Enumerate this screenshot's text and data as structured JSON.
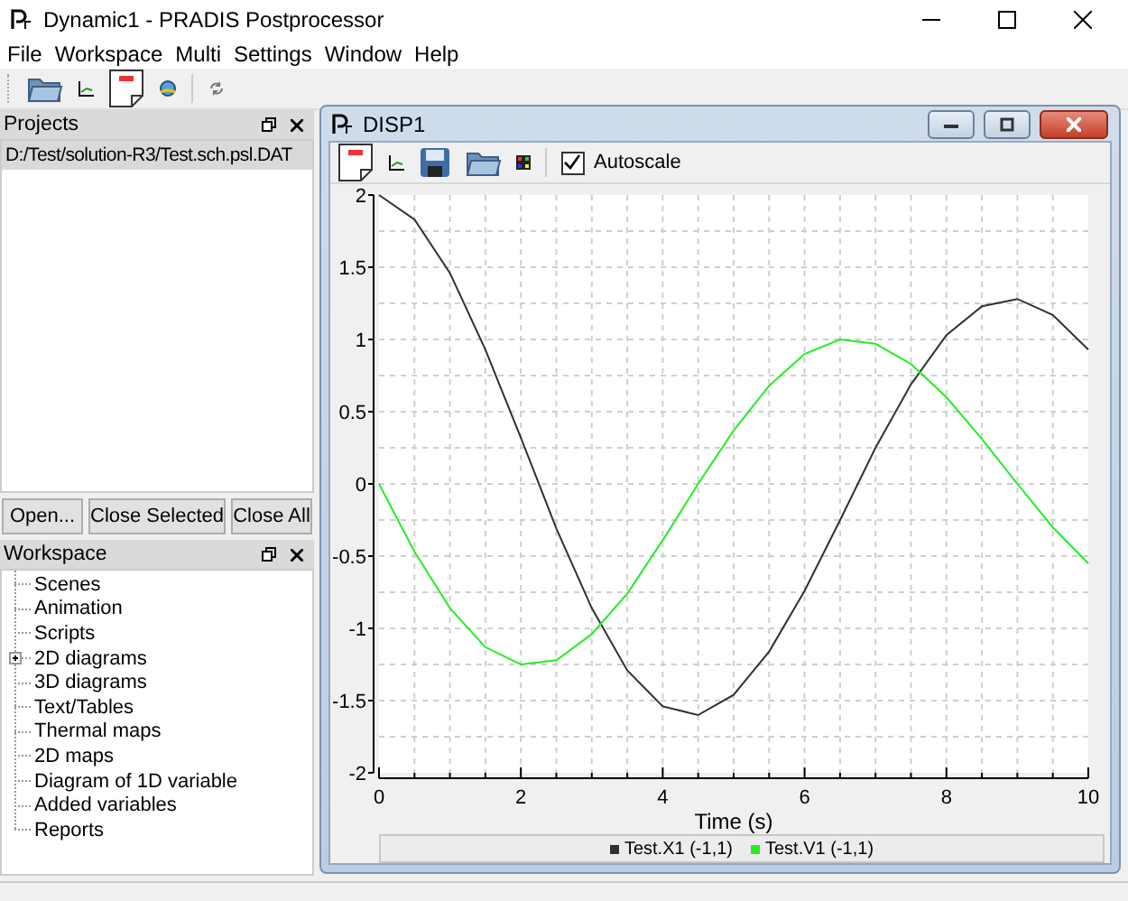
{
  "window": {
    "title": "Dynamic1 - PRADIS Postprocessor"
  },
  "menu": [
    "File",
    "Workspace",
    "Multi",
    "Settings",
    "Window",
    "Help"
  ],
  "projects_panel": {
    "title": "Projects",
    "items": [
      {
        "label": "D:/Test/solution-R3/Test.sch.psl.DAT",
        "selected": true
      }
    ],
    "buttons": [
      "Open...",
      "Close Selected",
      "Close All"
    ]
  },
  "workspace_panel": {
    "title": "Workspace",
    "items": [
      {
        "label": "Scenes",
        "expandable": false
      },
      {
        "label": "Animation",
        "expandable": false
      },
      {
        "label": "Scripts",
        "expandable": false
      },
      {
        "label": "2D diagrams",
        "expandable": true
      },
      {
        "label": "3D diagrams",
        "expandable": false
      },
      {
        "label": "Text/Tables",
        "expandable": false
      },
      {
        "label": "Thermal maps",
        "expandable": false
      },
      {
        "label": "2D maps",
        "expandable": false
      },
      {
        "label": "Diagram of 1D variable",
        "expandable": false
      },
      {
        "label": "Added variables",
        "expandable": false
      },
      {
        "label": "Reports",
        "expandable": false
      }
    ]
  },
  "plot_window": {
    "title": "DISP1",
    "autoscale": {
      "label": "Autoscale",
      "checked": true
    },
    "chart_data": {
      "type": "line",
      "xlabel": "Time (s)",
      "grid": true,
      "x": [
        0,
        0.5,
        1,
        1.5,
        2,
        2.5,
        3,
        3.5,
        4,
        4.5,
        5,
        5.5,
        6,
        6.5,
        7,
        7.5,
        8,
        8.5,
        9,
        9.5,
        10
      ],
      "series": [
        {
          "name": "Test.X1 (-1,1)",
          "color": "#303030",
          "values": [
            2.0,
            1.83,
            1.46,
            0.93,
            0.32,
            -0.31,
            -0.86,
            -1.29,
            -1.54,
            -1.6,
            -1.46,
            -1.16,
            -0.74,
            -0.25,
            0.25,
            0.69,
            1.03,
            1.23,
            1.28,
            1.17,
            0.93
          ]
        },
        {
          "name": "Test.V1 (-1,1)",
          "color": "#22ee22",
          "values": [
            0,
            -0.47,
            -0.86,
            -1.13,
            -1.25,
            -1.22,
            -1.04,
            -0.76,
            -0.39,
            0,
            0.37,
            0.68,
            0.9,
            1.0,
            0.97,
            0.83,
            0.6,
            0.31,
            0,
            -0.3,
            -0.55
          ]
        }
      ],
      "xlim": [
        0,
        10
      ],
      "ylim": [
        -2,
        2
      ],
      "xticks": [
        0,
        2,
        4,
        6,
        8,
        10
      ],
      "yticks": [
        -2,
        -1.5,
        -1,
        -0.5,
        0,
        0.5,
        1,
        1.5,
        2
      ]
    }
  }
}
